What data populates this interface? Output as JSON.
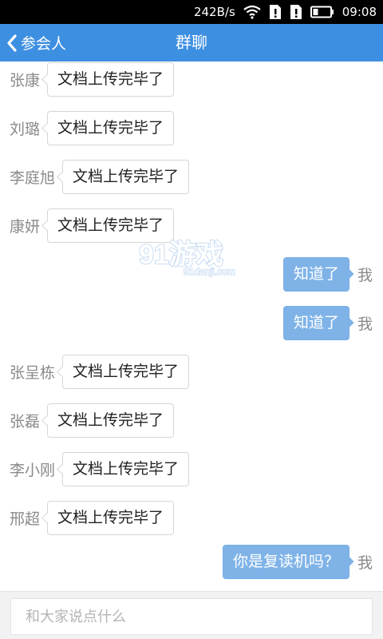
{
  "status_bar": {
    "network_speed": "242B/s",
    "time": "09:08",
    "icons": [
      "wifi-icon",
      "sim-1-icon",
      "sim-2-icon",
      "battery-icon"
    ]
  },
  "nav": {
    "back_label": "参会人",
    "title": "群聊",
    "color": "#3d8fe1"
  },
  "messages": [
    {
      "side": "left",
      "sender": "张康",
      "text": "文档上传完毕了"
    },
    {
      "side": "left",
      "sender": "刘璐",
      "text": "文档上传完毕了"
    },
    {
      "side": "left",
      "sender": "李庭旭",
      "text": "文档上传完毕了"
    },
    {
      "side": "left",
      "sender": "康妍",
      "text": "文档上传完毕了"
    },
    {
      "side": "right",
      "sender": "我",
      "text": "知道了"
    },
    {
      "side": "right",
      "sender": "我",
      "text": "知道了"
    },
    {
      "side": "left",
      "sender": "张呈栋",
      "text": "文档上传完毕了"
    },
    {
      "side": "left",
      "sender": "张磊",
      "text": "文档上传完毕了"
    },
    {
      "side": "left",
      "sender": "李小刚",
      "text": "文档上传完毕了"
    },
    {
      "side": "left",
      "sender": "邢超",
      "text": "文档上传完毕了"
    },
    {
      "side": "right",
      "sender": "我",
      "text": "你是复读机吗？"
    }
  ],
  "watermark": {
    "logo": "91游戏",
    "site": "91danji.com"
  },
  "input": {
    "placeholder": "和大家说点什么",
    "value": ""
  }
}
